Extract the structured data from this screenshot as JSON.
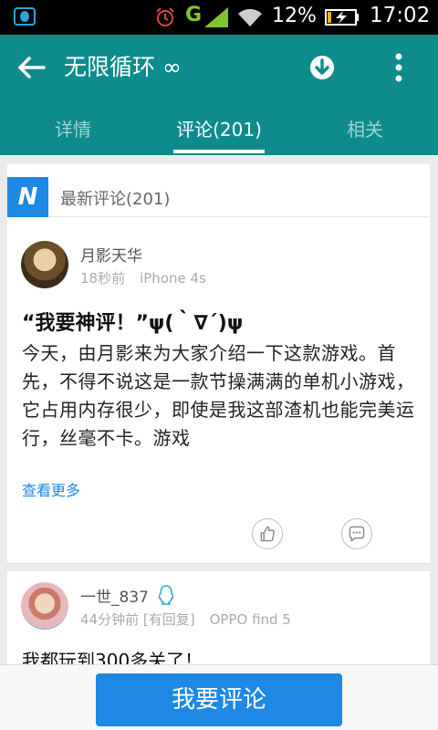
{
  "status_bar": {
    "network": "G",
    "battery_percent": "12%",
    "time": "17:02",
    "icons": [
      "qq-notification-icon",
      "alarm-icon",
      "signal-icon",
      "wifi-icon",
      "battery-charging-icon"
    ]
  },
  "app_bar": {
    "title": "无限循环 ∞",
    "icons": [
      "back-arrow-icon",
      "download-icon",
      "more-vert-icon"
    ],
    "tabs": [
      {
        "label": "详情"
      },
      {
        "label": "评论(201)",
        "active": true
      },
      {
        "label": "相关"
      }
    ]
  },
  "section": {
    "badge": "N",
    "title": "最新评论(201)"
  },
  "comments": [
    {
      "user": "月影天华",
      "time": "18秒前",
      "device": "iPhone 4s",
      "title": "“我要神评！”ψ(｀∇´)ψ",
      "body": "今天，由月影来为大家介绍一下这款游戏。首先，不得不说这是一款节操满满的单机小游戏，它占用内存很少，即使是我这部渣机也能完美运行，丝毫不卡。游戏",
      "see_more": "查看更多",
      "actions": [
        "thumb-up-icon",
        "chat-bubble-icon"
      ]
    },
    {
      "user": "一世_837",
      "time": "44分钟前",
      "reply_tag": "[有回复]",
      "device": "OPPO find 5",
      "body": "我都玩到300多关了！"
    }
  ],
  "bottom_bar": {
    "button_label": "我要评论"
  },
  "colors": {
    "app_bar": "#0e8c8c",
    "accent": "#1e88e5",
    "status_bar": "#000000"
  }
}
